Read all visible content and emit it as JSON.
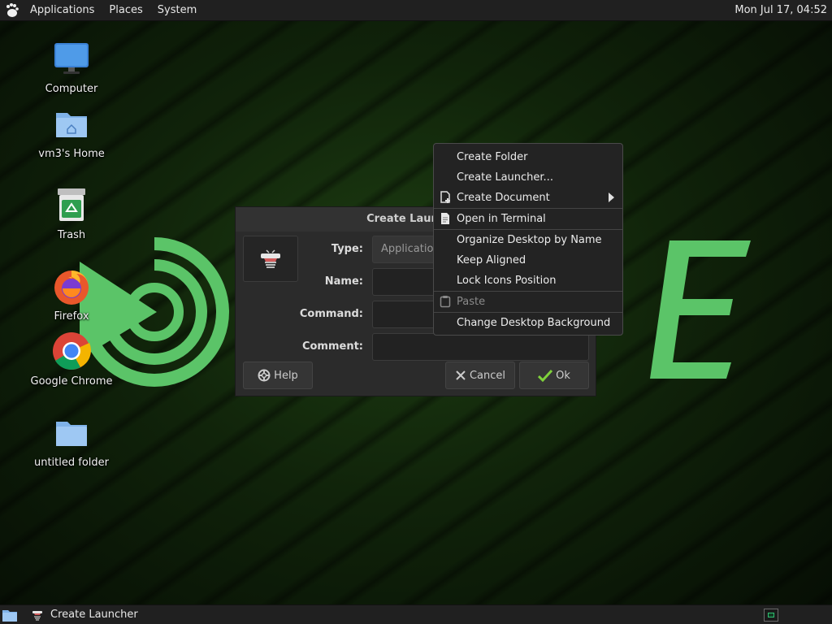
{
  "top_panel": {
    "menus": [
      "Applications",
      "Places",
      "System"
    ],
    "clock": "Mon Jul 17, 04:52"
  },
  "desktop": {
    "icons": [
      {
        "label": "Computer",
        "icon": "computer-icon"
      },
      {
        "label": "vm3's Home",
        "icon": "home-folder-icon"
      },
      {
        "label": "Trash",
        "icon": "trash-icon"
      },
      {
        "label": "Firefox",
        "icon": "firefox-icon"
      },
      {
        "label": "Google Chrome",
        "icon": "chrome-icon"
      },
      {
        "label": "untitled folder",
        "icon": "folder-icon"
      }
    ]
  },
  "dialog": {
    "title": "Create Launcher",
    "type_label": "Type:",
    "type_value": "Application",
    "name_label": "Name:",
    "name_value": "",
    "command_label": "Command:",
    "command_value": "",
    "comment_label": "Comment:",
    "comment_value": "",
    "help_label": "Help",
    "cancel_label": "Cancel",
    "ok_label": "Ok"
  },
  "context_menu": {
    "items": [
      {
        "label": "Create Folder",
        "enabled": true
      },
      {
        "label": "Create Launcher...",
        "enabled": true
      },
      {
        "label": "Create Document",
        "enabled": true,
        "submenu": true,
        "icon": "new-document-icon"
      },
      {
        "label": "Open in Terminal",
        "enabled": true,
        "icon": "terminal-document-icon"
      },
      {
        "label": "Organize Desktop by Name",
        "enabled": true
      },
      {
        "label": "Keep Aligned",
        "enabled": true
      },
      {
        "label": "Lock Icons Position",
        "enabled": true
      },
      {
        "label": "Paste",
        "enabled": false,
        "icon": "clipboard-icon"
      },
      {
        "label": "Change Desktop Background",
        "enabled": true
      }
    ]
  },
  "bottom_panel": {
    "task_label": "Create Launcher"
  },
  "colors": {
    "mate_green": "#5bc468",
    "panel_bg": "#202020",
    "ok_check": "#7fd13b"
  }
}
